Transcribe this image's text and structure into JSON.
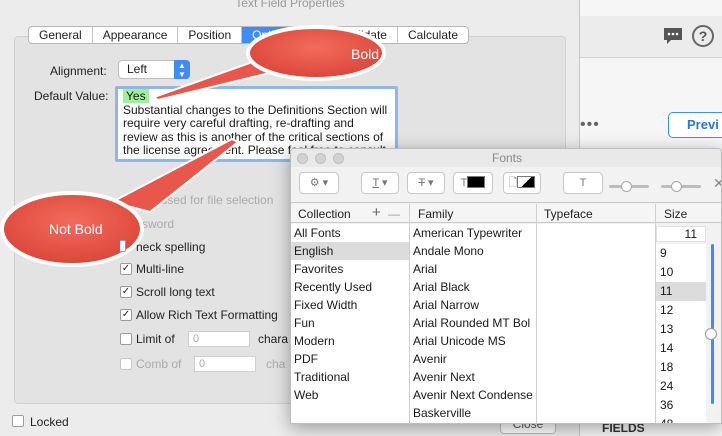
{
  "dialog": {
    "title": "Text Field Properties",
    "tabs": [
      {
        "label": "General"
      },
      {
        "label": "Appearance"
      },
      {
        "label": "Position"
      },
      {
        "label": "Options"
      },
      {
        "label": "Validate"
      },
      {
        "label": "Calculate"
      }
    ],
    "alignment": {
      "label": "Alignment:",
      "value": "Left"
    },
    "default_value": {
      "label": "Default Value:",
      "highlight": "Yes",
      "text": "Substantial changes to the Definitions Section will require very careful drafting, re-drafting and review as this is another of the critical sections of the license agreement. Please feel free to consult with the"
    },
    "options": [
      {
        "label": "Field is used for file selection",
        "visible_label": "ld is used for file selection",
        "checked": false,
        "disabled": true
      },
      {
        "label": "Password",
        "visible_label": "ssword",
        "checked": false,
        "disabled": true
      },
      {
        "label": "Check spelling",
        "visible_label": "heck spelling",
        "checked": true,
        "disabled": false
      },
      {
        "label": "Multi-line",
        "checked": true,
        "disabled": false
      },
      {
        "label": "Scroll long text",
        "checked": true,
        "disabled": false
      },
      {
        "label": "Allow Rich Text Formatting",
        "checked": true,
        "disabled": false
      },
      {
        "label": "Limit of",
        "checked": false,
        "disabled": false,
        "value": "0",
        "suffix": "chara"
      },
      {
        "label": "Comb of",
        "checked": false,
        "disabled": true,
        "value": "0",
        "suffix": "cha"
      }
    ],
    "locked_label": "Locked",
    "close_label": "Close"
  },
  "right_app": {
    "preview_label": "Previ",
    "more_dots": "•••",
    "fields_label": "FIELDS",
    "help_glyph": "?"
  },
  "fonts_panel": {
    "title": "Fonts",
    "headers": {
      "collection": "Collection",
      "add": "+",
      "remove": "—",
      "family": "Family",
      "typeface": "Typeface",
      "size": "Size"
    },
    "collections": [
      "All Fonts",
      "English",
      "Favorites",
      "Recently Used",
      "Fixed Width",
      "Fun",
      "Modern",
      "PDF",
      "Traditional",
      "Web"
    ],
    "selected_collection": "English",
    "families": [
      "American Typewriter",
      "Andale Mono",
      "Arial",
      "Arial Black",
      "Arial Narrow",
      "Arial Rounded MT Bol",
      "Arial Unicode MS",
      "Avenir",
      "Avenir Next",
      "Avenir Next Condense",
      "Baskerville"
    ],
    "size_value": "11",
    "sizes": [
      "9",
      "10",
      "11",
      "12",
      "13",
      "14",
      "18",
      "24",
      "36",
      "48"
    ],
    "selected_size": "11",
    "toolbar_glyph": "T"
  },
  "callouts": {
    "bold": "Bold",
    "not_bold": "Not Bold"
  },
  "colors": {
    "accent": "#3d8df5",
    "callout": "#e8574a",
    "yes_highlight": "#9ef09a"
  }
}
